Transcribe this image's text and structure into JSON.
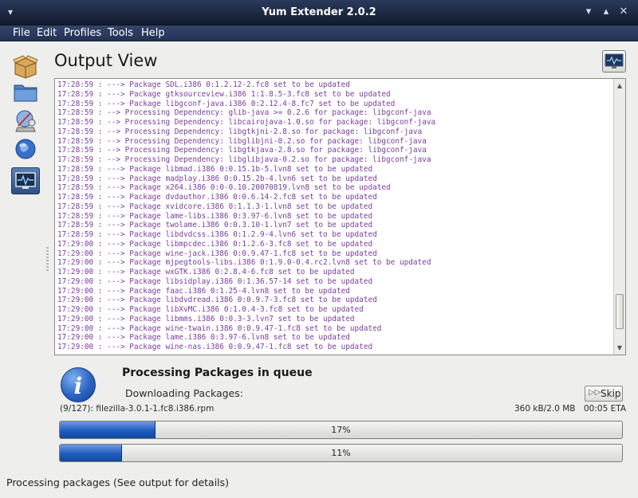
{
  "window": {
    "title": "Yum Extender 2.0.2"
  },
  "menubar": {
    "items": [
      "File",
      "Edit",
      "Profiles",
      "Tools",
      "Help"
    ]
  },
  "sidebar": {
    "items": [
      {
        "icon": "package-box-icon",
        "active": false
      },
      {
        "icon": "folder-icon",
        "active": false
      },
      {
        "icon": "repository-icon",
        "active": false
      },
      {
        "icon": "globe-icon",
        "active": false
      },
      {
        "icon": "output-monitor-icon",
        "active": true
      }
    ]
  },
  "header": {
    "title": "Output View",
    "icon": "monitor-icon"
  },
  "log": {
    "lines": [
      "17:28:59 : ---> Package SDL.i386 0:1.2.12-2.fc8 set to be updated",
      "17:28:59 : ---> Package gtksourceview.i386 1:1.8.5-3.fc8 set to be updated",
      "17:28:59 : ---> Package libgconf-java.i386 0:2.12.4-8.fc7 set to be updated",
      "17:28:59 : --> Processing Dependency: glib-java >= 0.2.6 for package: libgconf-java",
      "17:28:59 : --> Processing Dependency: libcairojava-1.0.so for package: libgconf-java",
      "17:28:59 : --> Processing Dependency: libgtkjni-2.8.so for package: libgconf-java",
      "17:28:59 : --> Processing Dependency: libglibjni-0.2.so for package: libgconf-java",
      "17:28:59 : --> Processing Dependency: libgtkjava-2.8.so for package: libgconf-java",
      "17:28:59 : --> Processing Dependency: libglibjava-0.2.so for package: libgconf-java",
      "17:28:59 : ---> Package libmad.i386 0:0.15.1b-5.lvn8 set to be updated",
      "17:28:59 : ---> Package madplay.i386 0:0.15.2b-4.lvn6 set to be updated",
      "17:28:59 : ---> Package x264.i386 0:0-0.10.20070819.lvn8 set to be updated",
      "17:28:59 : ---> Package dvdauthor.i386 0:0.6.14-2.fc8 set to be updated",
      "17:28:59 : ---> Package xvidcore.i386 0:1.1.3-1.lvn8 set to be updated",
      "17:28:59 : ---> Package lame-libs.i386 0:3.97-6.lvn8 set to be updated",
      "17:28:59 : ---> Package twolame.i386 0:0.3.10-1.lvn7 set to be updated",
      "17:28:59 : ---> Package libdvdcss.i386 0:1.2.9-4.lvn6 set to be updated",
      "17:29:00 : ---> Package libmpcdec.i386 0:1.2.6-3.fc8 set to be updated",
      "17:29:00 : ---> Package wine-jack.i386 0:0.9.47-1.fc8 set to be updated",
      "17:29:00 : ---> Package mjpegtools-libs.i386 0:1.9.0-0.4.rc2.lvn8 set to be updated",
      "17:29:00 : ---> Package wxGTK.i386 0:2.8.4-6.fc8 set to be updated",
      "17:29:00 : ---> Package libsidplay.i386 0:1.36.57-14 set to be updated",
      "17:29:00 : ---> Package faac.i386 0:1.25-4.lvn8 set to be updated",
      "17:29:00 : ---> Package libdvdread.i386 0:0.9.7-3.fc8 set to be updated",
      "17:29:00 : ---> Package libXvMC.i386 0:1.0.4-3.fc8 set to be updated",
      "17:29:00 : ---> Package libmms.i386 0:0.3-3.lvn7 set to be updated",
      "17:29:00 : ---> Package wine-twain.i386 0:0.9.47-1.fc8 set to be updated",
      "17:29:00 : ---> Package lame.i386 0:3.97-6.lvn8 set to be updated",
      "17:29:00 : ---> Package wine-nas.i386 0:0.9.47-1.fc8 set to be updated"
    ]
  },
  "progress": {
    "title": "Processing Packages in queue",
    "subtitle": "Downloading Packages:",
    "skip_label": "Skip",
    "file": "(9/127): filezilla-3.0.1-1.fc8.i386.rpm",
    "size": "360 kB/2.0 MB",
    "eta": "00:05 ETA",
    "bar1": {
      "label": "17%",
      "fraction": 0.17
    },
    "bar2": {
      "label": "11%",
      "fraction": 0.11
    }
  },
  "statusbar": {
    "text": "Processing packages (See output for details)"
  }
}
